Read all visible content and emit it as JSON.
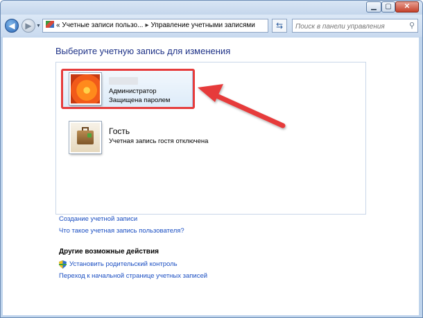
{
  "window": {
    "caption_buttons": [
      "minimize-icon",
      "maximize-icon",
      "close-icon"
    ]
  },
  "toolbar": {
    "back_icon": "back-arrow-icon",
    "forward_icon": "forward-arrow-icon",
    "address": {
      "chevron": "«",
      "crumb1": "Учетные записи пользо...",
      "crumb2": "Управление учетными записями"
    },
    "search": {
      "placeholder": "Поиск в панели управления"
    }
  },
  "main": {
    "heading": "Выберите учетную запись для изменения",
    "accounts": [
      {
        "name": "",
        "type": "Администратор",
        "status": "Защищена паролем",
        "picture": "flower-avatar-icon",
        "highlighted": true
      },
      {
        "name": "Гость",
        "type": "",
        "status": "Учетная запись гостя отключена",
        "picture": "suitcase-avatar-icon",
        "highlighted": false
      }
    ],
    "links": {
      "create_account": "Создание учетной записи",
      "what_is_account": "Что такое учетная запись пользователя?"
    },
    "other_actions": {
      "heading": "Другие возможные действия",
      "parental_control": "Установить родительский контроль",
      "go_to_main": "Переход к начальной странице учетных записей"
    }
  },
  "annotation": {
    "highlight_color": "#e63b3b"
  }
}
